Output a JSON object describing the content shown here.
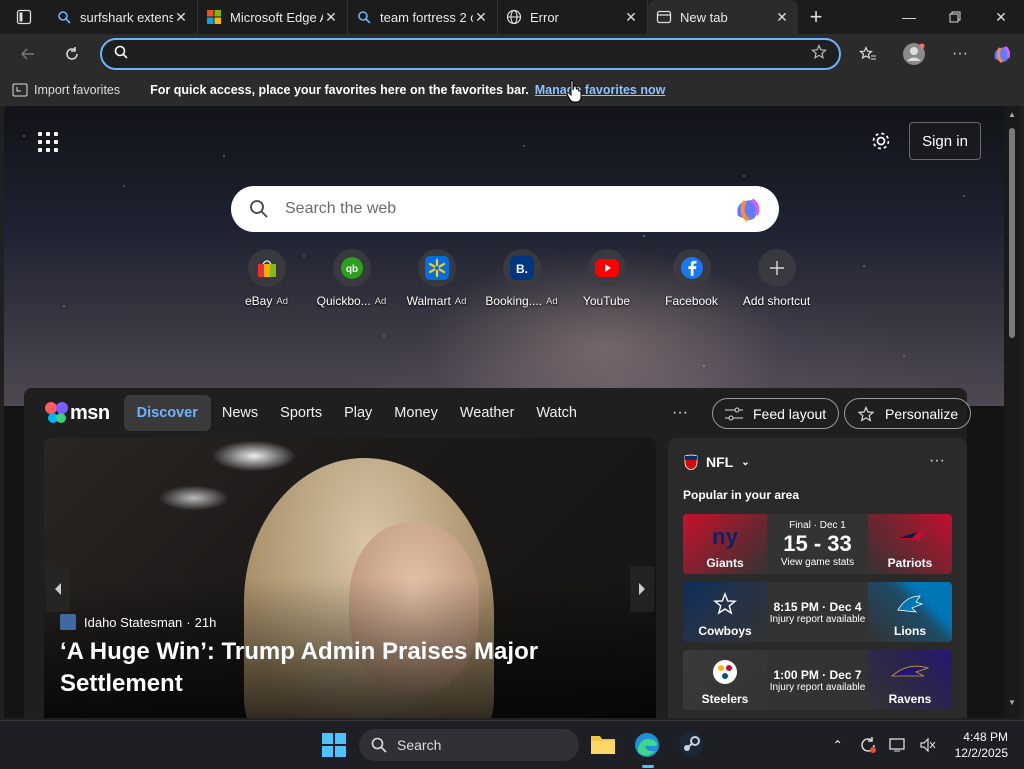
{
  "tabs": [
    {
      "title": "surfshark extension",
      "icon": "search-icon",
      "active": false
    },
    {
      "title": "Microsoft Edge A",
      "icon": "microsoft-logo-icon",
      "active": false
    },
    {
      "title": "team fortress 2 c",
      "icon": "search-icon",
      "active": false
    },
    {
      "title": "Error",
      "icon": "globe-icon",
      "active": false
    },
    {
      "title": "New tab",
      "icon": "new-tab-icon",
      "active": true
    }
  ],
  "address_bar": {
    "value": "",
    "placeholder": ""
  },
  "favorites_bar": {
    "import_label": "Import favorites",
    "message": "For quick access, place your favorites here on the favorites bar.",
    "manage_link": "Manage favorites now"
  },
  "newtab": {
    "sign_in": "Sign in",
    "search_placeholder": "Search the web",
    "shortcuts": [
      {
        "label": "eBay",
        "ad": "Ad",
        "icon": "ebay-bag-icon",
        "color": "#e53238"
      },
      {
        "label": "Quickbo...",
        "ad": "Ad",
        "icon": "quickbooks-icon",
        "color": "#2ca01c"
      },
      {
        "label": "Walmart",
        "ad": "Ad",
        "icon": "walmart-spark-icon",
        "color": "#0071dc"
      },
      {
        "label": "Booking....",
        "ad": "Ad",
        "icon": "booking-icon",
        "color": "#003580"
      },
      {
        "label": "YouTube",
        "ad": "",
        "icon": "youtube-icon",
        "color": "#ff0000"
      },
      {
        "label": "Facebook",
        "ad": "",
        "icon": "facebook-icon",
        "color": "#1877f2"
      },
      {
        "label": "Add shortcut",
        "ad": "",
        "icon": "plus-icon",
        "color": "#cccccc"
      }
    ]
  },
  "msn": {
    "logo": "msn",
    "nav": [
      "Discover",
      "News",
      "Sports",
      "Play",
      "Money",
      "Weather",
      "Watch"
    ],
    "active_nav": "Discover",
    "more": "···",
    "feed_layout": "Feed layout",
    "personalize": "Personalize",
    "hero": {
      "source": "Idaho Statesman",
      "age": "21h",
      "headline": "‘A Huge Win’: Trump Admin Praises Major Settlement"
    },
    "nfl": {
      "title": "NFL",
      "subtitle": "Popular in your area",
      "games": [
        {
          "home": "Giants",
          "away": "Patriots",
          "status": "Final · Dec 1",
          "main": "15 - 33",
          "sub": "View game stats",
          "home_color": "#0b2265",
          "away_color": "#c60c30"
        },
        {
          "home": "Cowboys",
          "away": "Lions",
          "status": "",
          "main": "8:15 PM · Dec 4",
          "sub": "Injury report available",
          "home_color": "#041e42",
          "away_color": "#0076b6"
        },
        {
          "home": "Steelers",
          "away": "Ravens",
          "status": "",
          "main": "1:00 PM · Dec 7",
          "sub": "Injury report available",
          "home_color": "#2a2a2a",
          "away_color": "#241773"
        }
      ]
    }
  },
  "taskbar": {
    "search": "Search",
    "time": "4:48 PM",
    "date": "12/2/2025"
  }
}
